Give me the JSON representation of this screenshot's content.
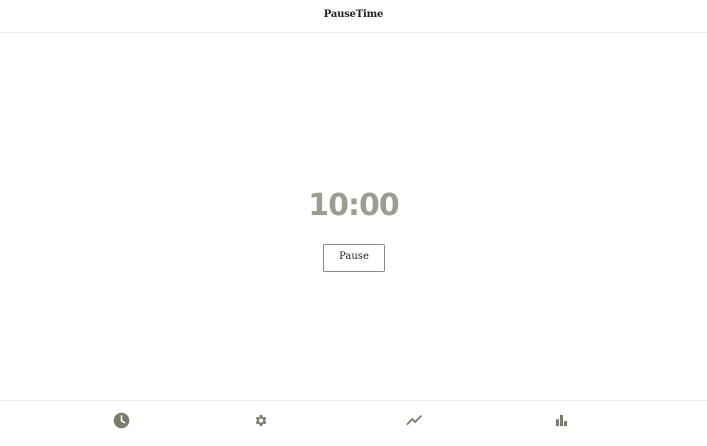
{
  "header": {
    "title": "PauseTime"
  },
  "timer": {
    "display": "10:00"
  },
  "controls": {
    "pause_label": "Pause"
  },
  "bottom_nav": {
    "items": [
      {
        "icon": "clock-icon"
      },
      {
        "icon": "gear-icon"
      },
      {
        "icon": "trending-icon"
      },
      {
        "icon": "bar-chart-icon"
      }
    ]
  },
  "colors": {
    "timer_text": "#9e9b90",
    "icon": "#7d7b6c",
    "divider": "#ececec"
  }
}
